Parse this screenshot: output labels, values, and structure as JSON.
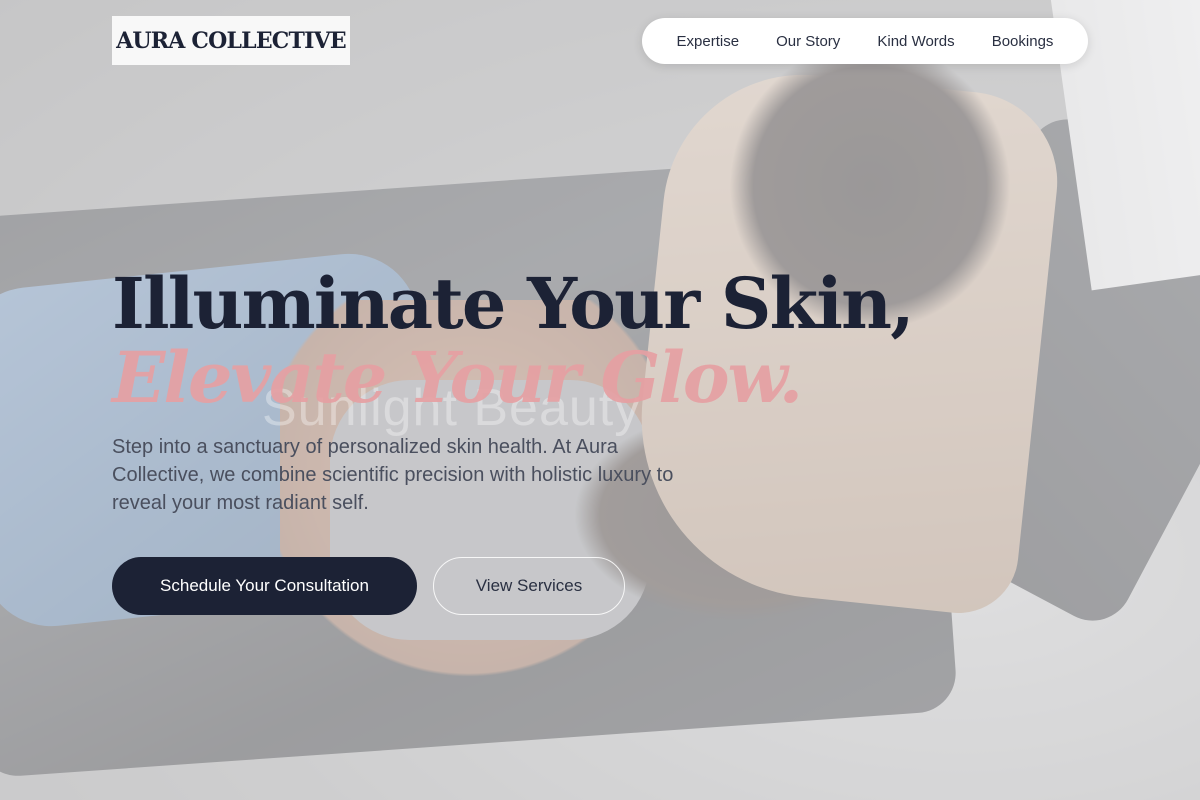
{
  "brand": {
    "logo_text": "AURA COLLECTIVE"
  },
  "nav": {
    "items": [
      {
        "label": "Expertise"
      },
      {
        "label": "Our Story"
      },
      {
        "label": "Kind Words"
      },
      {
        "label": "Bookings"
      }
    ]
  },
  "hero": {
    "headline_line1": "Illuminate Your Skin,",
    "headline_line2": "Elevate Your Glow.",
    "watermark": "Sunlight Beauty",
    "subtext": "Step into a sanctuary of personalized skin health. At Aura Collective, we combine scientific precision with holistic luxury to reveal your most radiant self.",
    "primary_cta": "Schedule Your Consultation",
    "secondary_cta": "View Services"
  },
  "colors": {
    "navy": "#1c2235",
    "rose_accent": "#e6a0a3",
    "nav_background": "#ffffff"
  }
}
